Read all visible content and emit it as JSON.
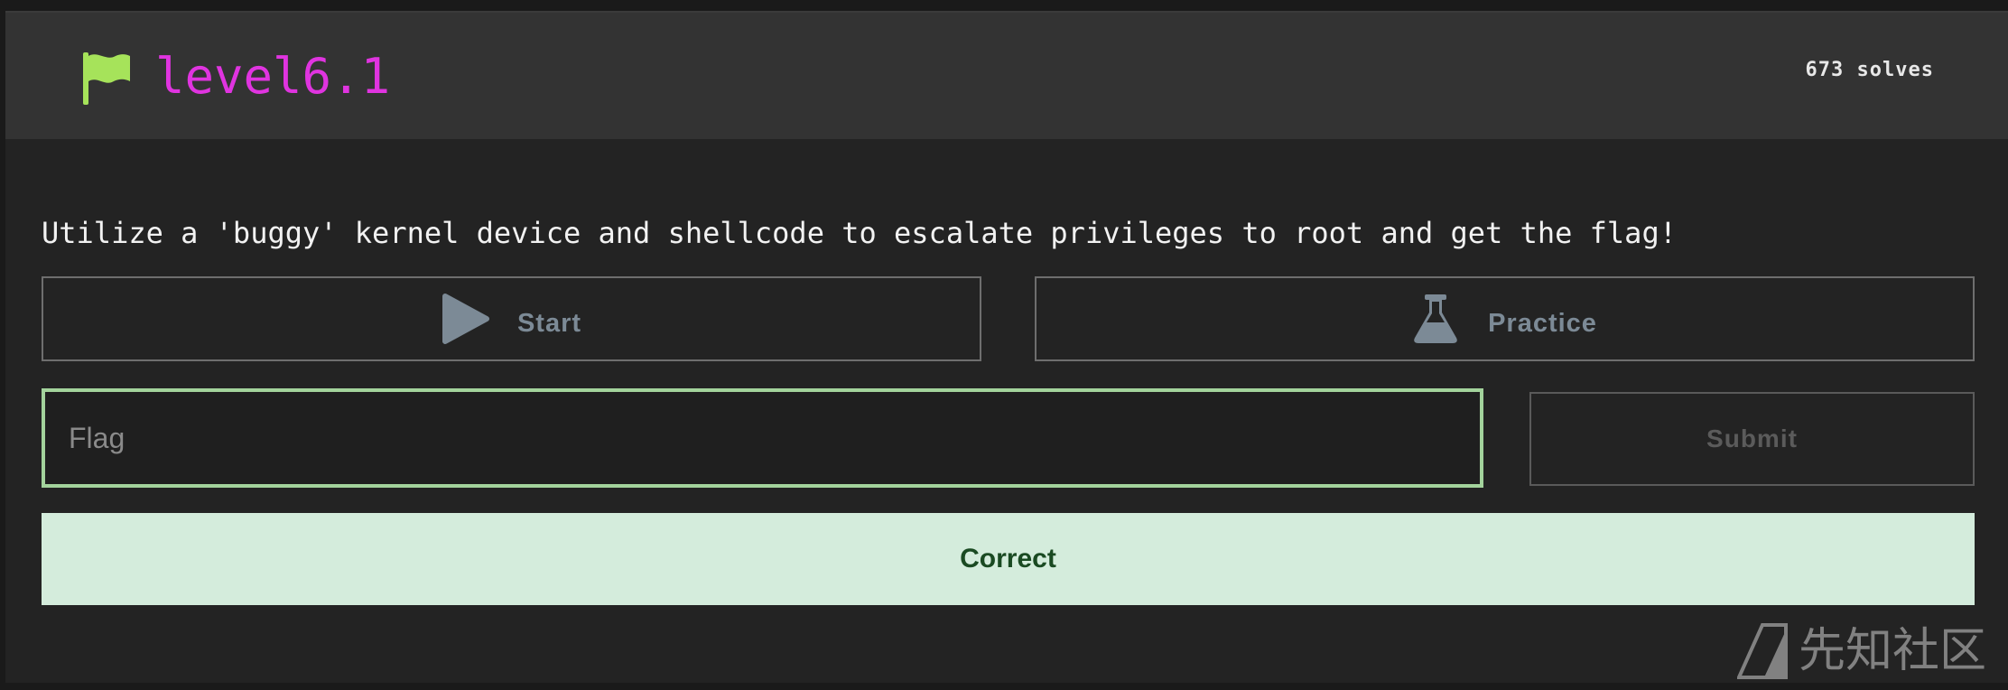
{
  "challenge": {
    "title": "level6.1",
    "solves": "673 solves",
    "description": "Utilize a 'buggy' kernel device and shellcode to escalate privileges to root and get the flag!"
  },
  "actions": {
    "start_label": "Start",
    "practice_label": "Practice"
  },
  "flag_form": {
    "placeholder": "Flag",
    "value": "",
    "submit_label": "Submit"
  },
  "result": {
    "message": "Correct"
  },
  "watermark": {
    "text": "先知社区"
  },
  "icons": {
    "title_icon": "flag-icon",
    "start_icon": "play-icon",
    "practice_icon": "flask-icon"
  },
  "colors": {
    "title": "#e034e0",
    "flag_icon": "#a6e35a",
    "input_border": "#a3d39c",
    "correct_bg": "#d4ecdc",
    "correct_text": "#1a4a22",
    "button_text": "#7c8a96"
  }
}
